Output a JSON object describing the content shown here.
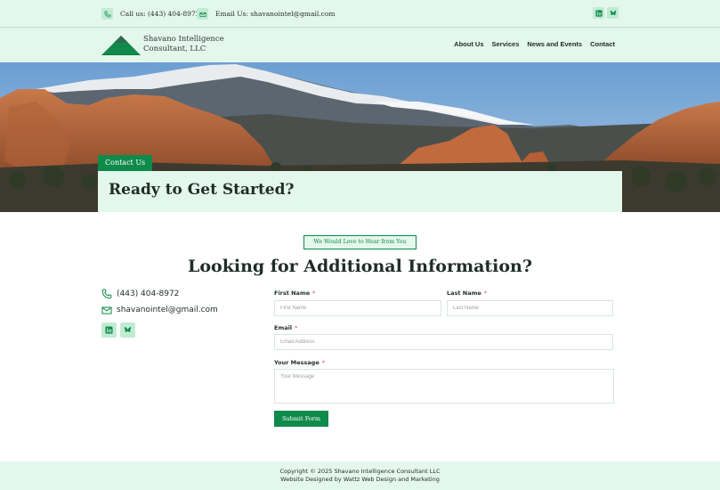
{
  "topbar": {
    "phone": "Call us: (443) 404-8972",
    "email": "Email Us: shavanointel@gmail.com",
    "social": [
      "linkedin-icon",
      "bluesky-icon"
    ]
  },
  "header": {
    "logo_line1": "Shavano Intelligence",
    "logo_line2": "Consultant, LLC",
    "nav": [
      "About Us",
      "Services",
      "News and Events",
      "Contact"
    ]
  },
  "hero": {
    "tag": "Contact Us",
    "title": "Ready to Get Started?"
  },
  "section": {
    "badge": "We Would Love to Hear from You",
    "heading": "Looking for Additional Information?"
  },
  "contact": {
    "phone": "(443) 404-8972",
    "email": "shavanointel@gmail.com"
  },
  "form": {
    "first_name_label": "First Name",
    "first_name_placeholder": "First Name",
    "last_name_label": "Last Name",
    "last_name_placeholder": "Last Name",
    "email_label": "Email",
    "email_placeholder": "Email Address",
    "message_label": "Your Message",
    "message_placeholder": "Your Message",
    "required_mark": "*",
    "submit_label": "Submit Form"
  },
  "footer": {
    "copyright": "Copyright © 2025 Shavano Intelligence Consultant LLC",
    "credit": "Website Designed by Wattz Web Design and Marketing"
  },
  "colors": {
    "brand_green": "#0f8a4a",
    "mint_bg": "#e3f7ec",
    "required": "#e0453a"
  }
}
